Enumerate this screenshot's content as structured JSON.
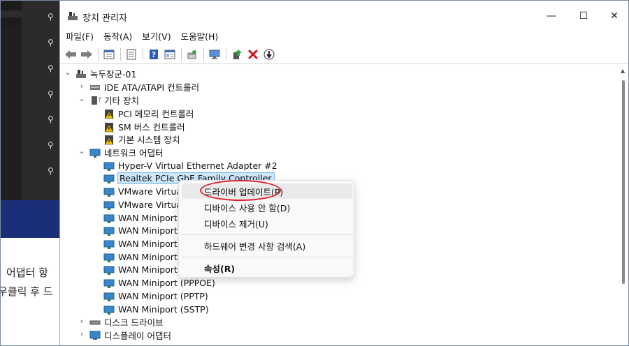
{
  "background": {
    "text_lines": [
      "어댑터 항",
      "우클릭 후 드"
    ]
  },
  "window": {
    "title": "장치 관리자",
    "controls": {
      "minimize": "—",
      "maximize": "☐",
      "close": "✕"
    }
  },
  "menu": [
    "파일(F)",
    "동작(A)",
    "보기(V)",
    "도움말(H)"
  ],
  "toolbar": {
    "buttons": [
      "back-icon",
      "forward-icon",
      "properties-view-icon",
      "list-view-icon",
      "help-icon",
      "details-view-icon",
      "scan-hardware-icon",
      "monitor-icon",
      "update-driver-icon",
      "uninstall-icon",
      "download-icon"
    ]
  },
  "tree": {
    "root": "녹두장군-01",
    "nodes": [
      {
        "label": "IDE ATA/ATAPI 컨트롤러",
        "level": 1,
        "expanded": false,
        "icon": "ide-controller-icon"
      },
      {
        "label": "기타 장치",
        "level": 1,
        "expanded": true,
        "icon": "other-devices-icon"
      },
      {
        "label": "PCI 메모리 컨트롤러",
        "level": 2,
        "icon": "warning-device-icon"
      },
      {
        "label": "SM 버스 컨트롤러",
        "level": 2,
        "icon": "warning-device-icon"
      },
      {
        "label": "기본 시스템 장치",
        "level": 2,
        "icon": "warning-device-icon"
      },
      {
        "label": "네트워크 어댑터",
        "level": 1,
        "expanded": true,
        "icon": "network-adapter-icon"
      },
      {
        "label": "Hyper-V Virtual Ethernet Adapter #2",
        "level": 2,
        "icon": "network-adapter-icon"
      },
      {
        "label": "Realtek PCIe GbE Family Controller",
        "level": 2,
        "icon": "network-adapter-icon",
        "selected": true
      },
      {
        "label": "VMware Virtua",
        "level": 2,
        "icon": "network-adapter-icon"
      },
      {
        "label": "VMware Virtua",
        "level": 2,
        "icon": "network-adapter-icon"
      },
      {
        "label": "WAN Miniport",
        "level": 2,
        "icon": "network-adapter-icon"
      },
      {
        "label": "WAN Miniport",
        "level": 2,
        "icon": "network-adapter-icon"
      },
      {
        "label": "WAN Miniport",
        "level": 2,
        "icon": "network-adapter-icon"
      },
      {
        "label": "WAN Miniport",
        "level": 2,
        "icon": "network-adapter-icon"
      },
      {
        "label": "WAN Miniport",
        "level": 2,
        "icon": "network-adapter-icon"
      },
      {
        "label": "WAN Miniport (PPPOE)",
        "level": 2,
        "icon": "network-adapter-icon"
      },
      {
        "label": "WAN Miniport (PPTP)",
        "level": 2,
        "icon": "network-adapter-icon"
      },
      {
        "label": "WAN Miniport (SSTP)",
        "level": 2,
        "icon": "network-adapter-icon"
      },
      {
        "label": "디스크 드라이브",
        "level": 1,
        "expanded": false,
        "icon": "disk-drive-icon"
      },
      {
        "label": "디스플레이 어댑터",
        "level": 1,
        "expanded": false,
        "icon": "display-adapter-icon"
      }
    ]
  },
  "context_menu": {
    "items": [
      {
        "label": "드라이버 업데이트(P)",
        "hover": true
      },
      {
        "label": "디바이스 사용 안 함(D)"
      },
      {
        "label": "디바이스 제거(U)"
      },
      {
        "label": "하드웨어 변경 사항 검색(A)"
      },
      {
        "label": "속성(R)",
        "bold": true
      }
    ]
  },
  "colors": {
    "selection": "#cce8ff",
    "annotation_ellipse": "#d8252d",
    "background_navy": "#1a2f78"
  }
}
